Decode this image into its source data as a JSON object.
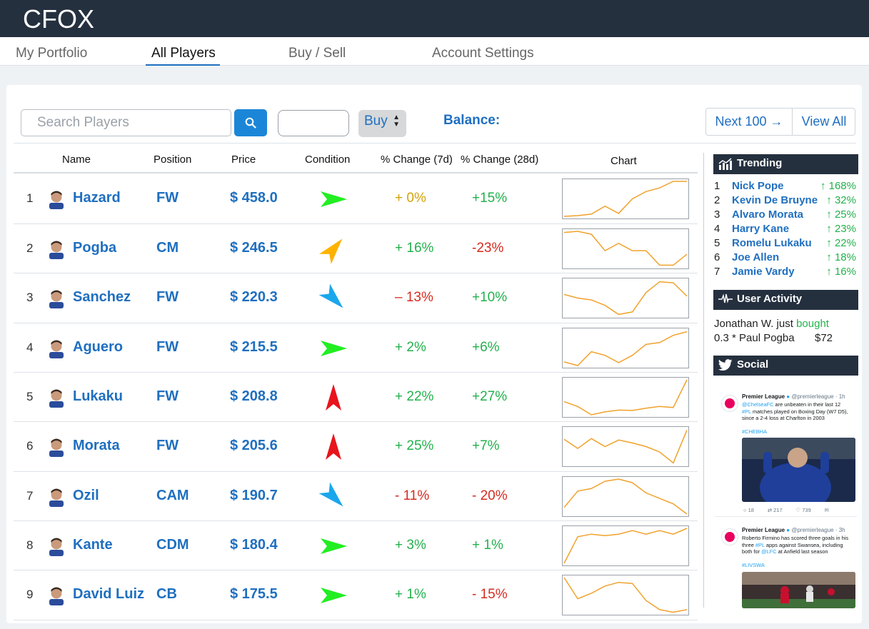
{
  "app": {
    "logo": "CFOX"
  },
  "nav": {
    "tabs": [
      {
        "label": "My Portfolio",
        "active": false
      },
      {
        "label": "All Players",
        "active": true
      },
      {
        "label": "Buy / Sell",
        "active": false
      },
      {
        "label": "Account Settings",
        "active": false
      }
    ]
  },
  "toolbar": {
    "search_placeholder": "Search Players",
    "search_icon": "search-icon",
    "quantity_value": "",
    "action_select": "Buy",
    "balance_label": "Balance:",
    "next_label": "Next 100 →",
    "view_all_label": "View All"
  },
  "table": {
    "headers": [
      "Name",
      "Position",
      "Price",
      "Condition",
      "% Change (7d)",
      "% Change (28d)",
      "Chart"
    ],
    "rows": [
      {
        "rank": "1",
        "name": "Hazard",
        "position": "FW",
        "price": "$ 458.0",
        "condition": "right",
        "condition_color": "#22ee22",
        "change7": "+ 0%",
        "change7_color": "#d4a20a",
        "change28": "+15%",
        "change28_color": "#22b14c",
        "chart": [
          0.02,
          0.04,
          0.08,
          0.3,
          0.1,
          0.5,
          0.7,
          0.8,
          0.98,
          0.98
        ]
      },
      {
        "rank": "2",
        "name": "Pogba",
        "position": "CM",
        "price": "$ 246.5",
        "condition": "up-right",
        "condition_color": "#ffb300",
        "change7": "+ 16%",
        "change7_color": "#22b14c",
        "change28": "-23%",
        "change28_color": "#d62b1f",
        "chart": [
          0.95,
          0.98,
          0.9,
          0.45,
          0.65,
          0.45,
          0.45,
          0.05,
          0.05,
          0.35
        ]
      },
      {
        "rank": "3",
        "name": "Sanchez",
        "position": "FW",
        "price": "$ 220.3",
        "condition": "down-right",
        "condition_color": "#1aa7ec",
        "change7": "– 13%",
        "change7_color": "#d62b1f",
        "change28": "+10%",
        "change28_color": "#22b14c",
        "chart": [
          0.6,
          0.5,
          0.45,
          0.3,
          0.05,
          0.12,
          0.65,
          0.95,
          0.92,
          0.55
        ]
      },
      {
        "rank": "4",
        "name": "Aguero",
        "position": "FW",
        "price": "$ 215.5",
        "condition": "right",
        "condition_color": "#22ee22",
        "change7": "+ 2%",
        "change7_color": "#22b14c",
        "change28": "+6%",
        "change28_color": "#22b14c",
        "chart": [
          0.12,
          0.02,
          0.4,
          0.3,
          0.1,
          0.3,
          0.6,
          0.65,
          0.85,
          0.95
        ]
      },
      {
        "rank": "5",
        "name": "Lukaku",
        "position": "FW",
        "price": "$ 208.8",
        "condition": "up",
        "condition_color": "#e8141c",
        "change7": "+ 22%",
        "change7_color": "#22b14c",
        "change28": "+27%",
        "change28_color": "#22b14c",
        "chart": [
          0.38,
          0.25,
          0.02,
          0.1,
          0.15,
          0.14,
          0.2,
          0.25,
          0.22,
          0.98
        ]
      },
      {
        "rank": "6",
        "name": "Morata",
        "position": "FW",
        "price": "$ 205.6",
        "condition": "up",
        "condition_color": "#e8141c",
        "change7": "+ 25%",
        "change7_color": "#22b14c",
        "change28": "+7%",
        "change28_color": "#22b14c",
        "chart": [
          0.7,
          0.45,
          0.72,
          0.5,
          0.68,
          0.6,
          0.5,
          0.35,
          0.05,
          0.95
        ]
      },
      {
        "rank": "7",
        "name": "Ozil",
        "position": "CAM",
        "price": "$ 190.7",
        "condition": "down-right",
        "condition_color": "#1aa7ec",
        "change7": "- 11%",
        "change7_color": "#d62b1f",
        "change28": "- 20%",
        "change28_color": "#d62b1f",
        "chart": [
          0.2,
          0.65,
          0.72,
          0.92,
          0.98,
          0.88,
          0.6,
          0.45,
          0.3,
          0.02
        ]
      },
      {
        "rank": "8",
        "name": "Kante",
        "position": "CDM",
        "price": "$ 180.4",
        "condition": "right",
        "condition_color": "#22ee22",
        "change7": "+ 3%",
        "change7_color": "#22b14c",
        "change28": "+ 1%",
        "change28_color": "#22b14c",
        "chart": [
          0.02,
          0.75,
          0.82,
          0.78,
          0.82,
          0.92,
          0.82,
          0.92,
          0.82,
          0.98
        ]
      },
      {
        "rank": "9",
        "name": "David Luiz",
        "position": "CB",
        "price": "$ 175.5",
        "condition": "right",
        "condition_color": "#22ee22",
        "change7": "+ 1%",
        "change7_color": "#22b14c",
        "change28": "- 15%",
        "change28_color": "#d62b1f",
        "chart": [
          0.98,
          0.4,
          0.55,
          0.75,
          0.85,
          0.82,
          0.35,
          0.1,
          0.03,
          0.1
        ]
      }
    ]
  },
  "sidebar": {
    "trending": {
      "title": "Trending",
      "icon": "chart-icon",
      "items": [
        {
          "rank": "1",
          "name": "Nick Pope",
          "change": "↑ 168%"
        },
        {
          "rank": "2",
          "name": "Kevin De Bruyne",
          "change": "↑ 32%"
        },
        {
          "rank": "3",
          "name": "Alvaro Morata",
          "change": "↑ 25%"
        },
        {
          "rank": "4",
          "name": "Harry Kane",
          "change": "↑ 23%"
        },
        {
          "rank": "5",
          "name": "Romelu Lukaku",
          "change": "↑ 22%"
        },
        {
          "rank": "6",
          "name": "Joe Allen",
          "change": "↑ 18%"
        },
        {
          "rank": "7",
          "name": "Jamie Vardy",
          "change": "↑ 16%"
        }
      ]
    },
    "activity": {
      "title": "User Activity",
      "icon": "pulse-icon",
      "user": "Jonathan W. just",
      "verb": "bought",
      "detail": "0.3 * Paul Pogba",
      "amount": "$72"
    },
    "social": {
      "title": "Social",
      "icon": "twitter-icon",
      "tweets": [
        {
          "name": "Premier League",
          "handle": "@premierleague · 1h",
          "mention": "@ChelseaFC",
          "text1": "are unbeaten in their last 12",
          "hashtag_inline": "#PL",
          "text2": "matches played on Boxing Day (W7 D5), since a 2-4 loss at Charlton in 2003",
          "hashtag": "#CHEBHA",
          "replies": "18",
          "retweets": "217",
          "likes": "739"
        },
        {
          "name": "Premier League",
          "handle": "@premierleague · 3h",
          "text1": "Roberto Firmino has scored three goals in his three",
          "hashtag_inline": "#PL",
          "text2": "apps against Swansea, including both for",
          "mention": "@LFC",
          "text3": "at Anfield last season",
          "hashtag": "#LIVSWA"
        }
      ]
    }
  }
}
